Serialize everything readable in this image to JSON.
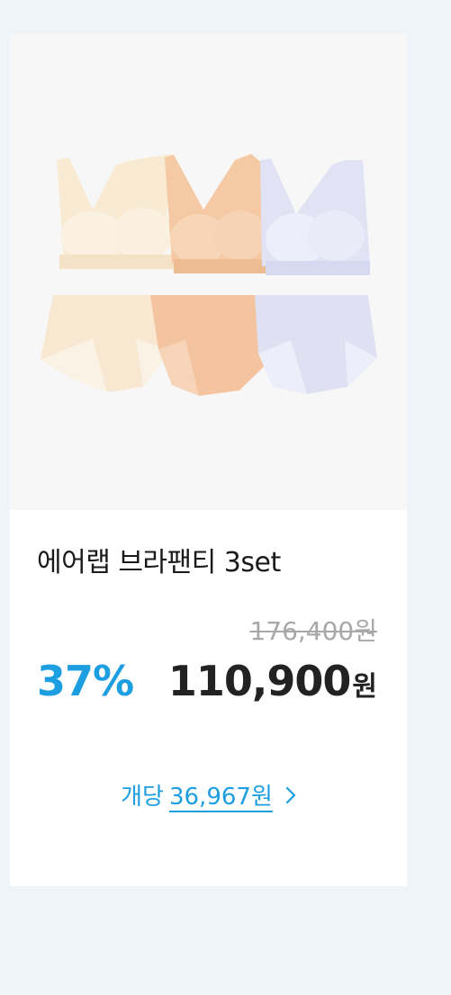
{
  "product": {
    "name": "에어랩 브라팬티 3set",
    "original_price": "176,400원",
    "discount_rate": "37%",
    "sale_price": "110,900",
    "sale_price_unit": "원",
    "unit_price_label": "개당",
    "unit_price_value": "36,967원",
    "unit_price_icon": "chevron-right-icon",
    "image_colors": [
      "#f7e6cf",
      "#f5c9a4",
      "#dcdff3"
    ],
    "accent_color": "#1c9ee0"
  }
}
